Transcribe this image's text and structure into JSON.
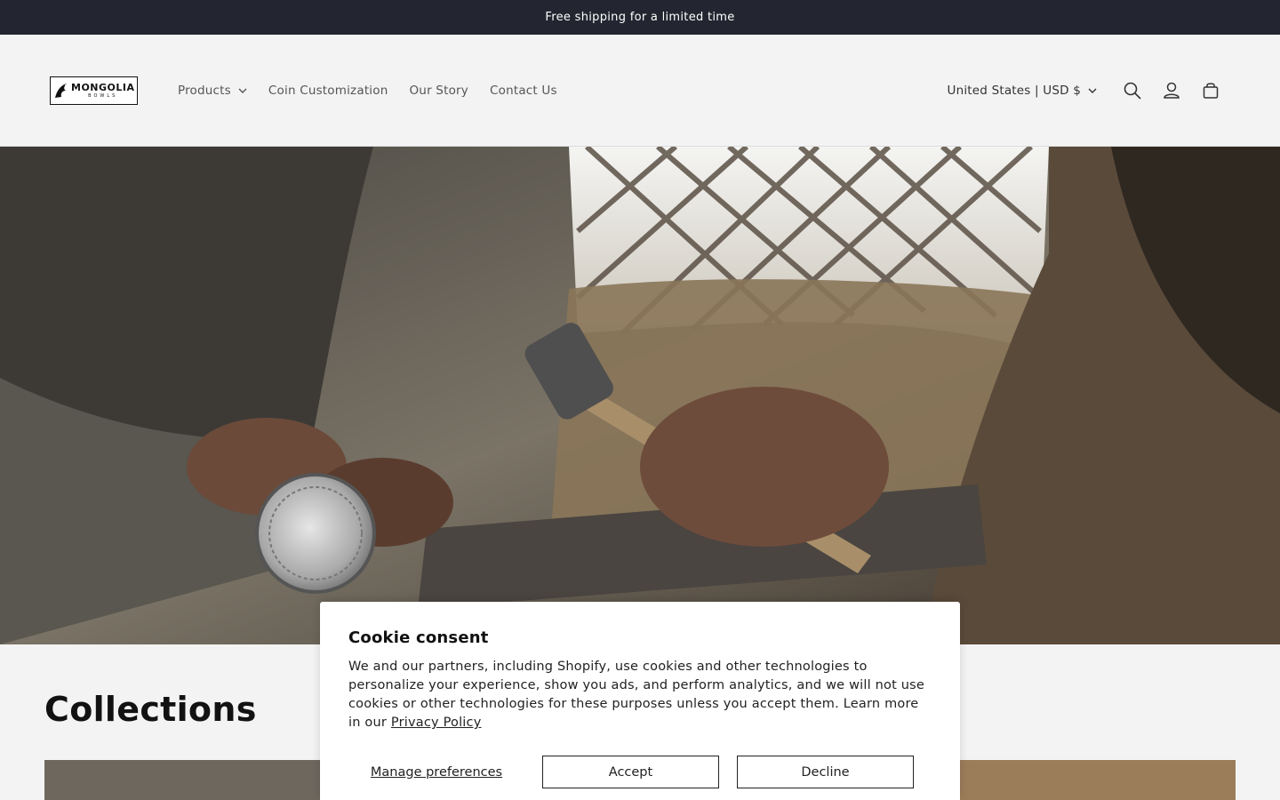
{
  "announcement": {
    "text": "Free shipping for a limited time"
  },
  "header": {
    "logo": {
      "main": "MONGOLIA",
      "sub": "BOWLS"
    },
    "nav": [
      {
        "label": "Products",
        "has_dropdown": true
      },
      {
        "label": "Coin Customization",
        "has_dropdown": false
      },
      {
        "label": "Our Story",
        "has_dropdown": false
      },
      {
        "label": "Contact Us",
        "has_dropdown": false
      }
    ],
    "country_selector": "United States | USD $",
    "icons": [
      "search-icon",
      "account-icon",
      "cart-icon"
    ]
  },
  "hero": {
    "image": "craftsman-hammering-silver-coin"
  },
  "collections": {
    "title": "Collections"
  },
  "cookie": {
    "title": "Cookie consent",
    "text": "We and our partners, including Shopify, use cookies and other technologies to personalize your experience, show you ads, and perform analytics, and we will not use cookies or other technologies for these purposes unless you accept them. Learn more in our ",
    "link_text": "Privacy Policy",
    "manage_label": "Manage preferences",
    "accept_label": "Accept",
    "decline_label": "Decline"
  }
}
